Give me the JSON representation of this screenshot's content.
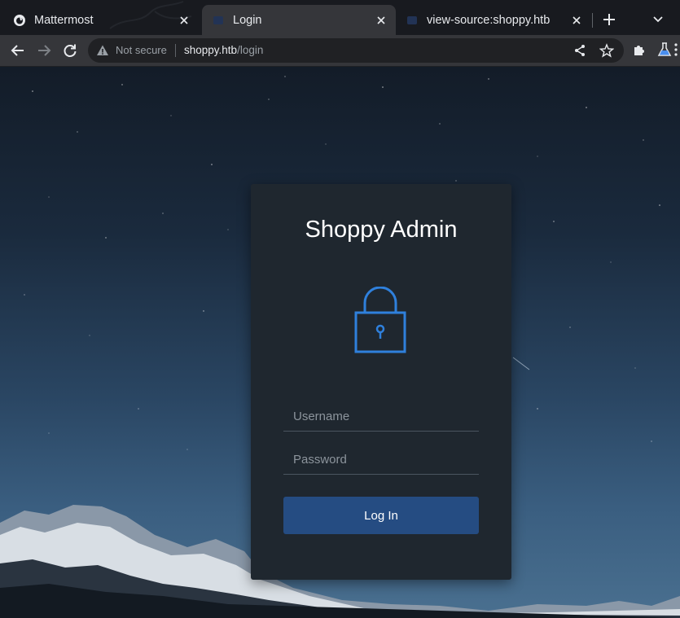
{
  "browser": {
    "tabs": [
      {
        "title": "Mattermost",
        "active": false,
        "favicon": "mattermost-icon"
      },
      {
        "title": "Login",
        "active": true,
        "favicon": "page-icon"
      },
      {
        "title": "view-source:shoppy.htb",
        "active": false,
        "favicon": "page-icon"
      }
    ],
    "security_label": "Not secure",
    "url_host": "shoppy.htb",
    "url_path": "/login"
  },
  "login": {
    "title": "Shoppy Admin",
    "username_placeholder": "Username",
    "password_placeholder": "Password",
    "button_label": "Log In"
  },
  "colors": {
    "accent": "#2f80dc",
    "button": "#254c82",
    "card": "#1f272f"
  }
}
